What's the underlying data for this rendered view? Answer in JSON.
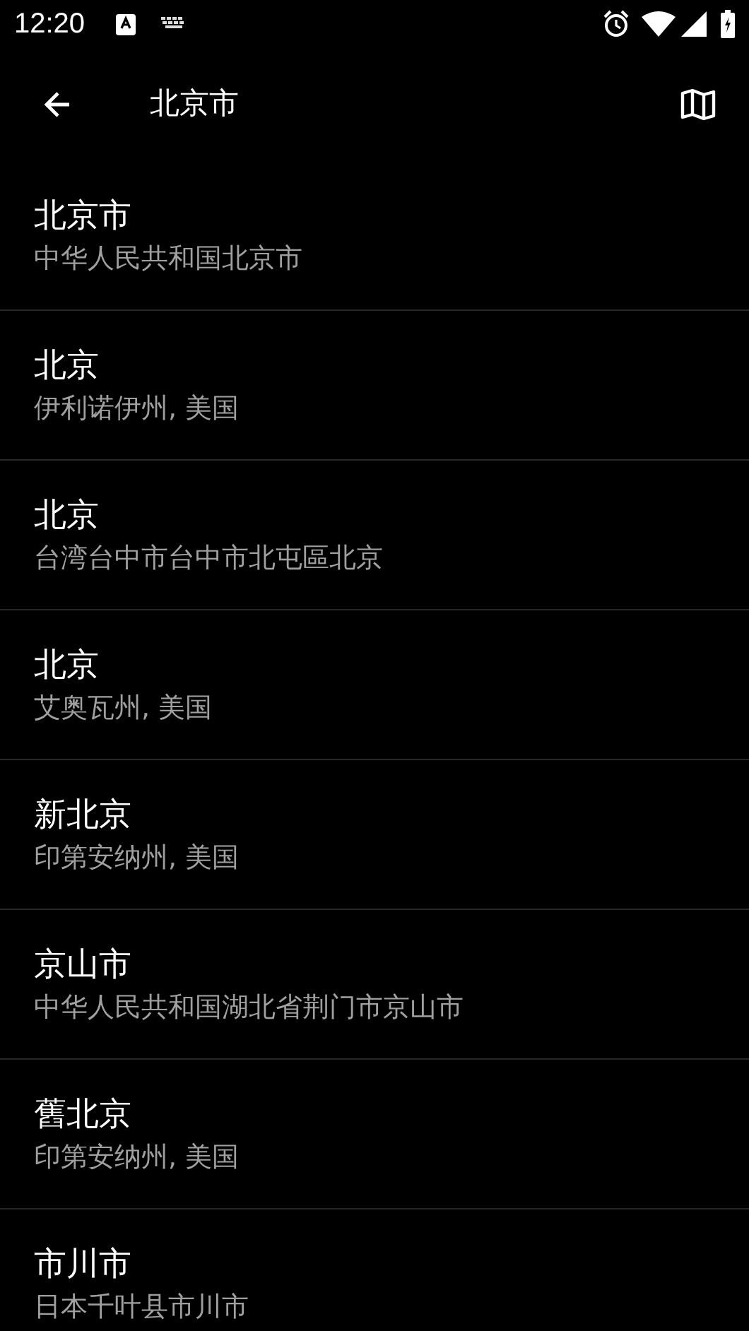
{
  "status_bar": {
    "time": "12:20"
  },
  "toolbar": {
    "title": "北京市"
  },
  "results": [
    {
      "name": "北京市",
      "location": "中华人民共和国北京市"
    },
    {
      "name": "北京",
      "location": "伊利诺伊州, 美国"
    },
    {
      "name": "北京",
      "location": "台湾台中市台中市北屯區北京"
    },
    {
      "name": "北京",
      "location": "艾奥瓦州, 美国"
    },
    {
      "name": "新北京",
      "location": "印第安纳州, 美国"
    },
    {
      "name": "京山市",
      "location": "中华人民共和国湖北省荆门市京山市"
    },
    {
      "name": "舊北京",
      "location": "印第安纳州, 美国"
    },
    {
      "name": "市川市",
      "location": "日本千叶县市川市"
    }
  ]
}
